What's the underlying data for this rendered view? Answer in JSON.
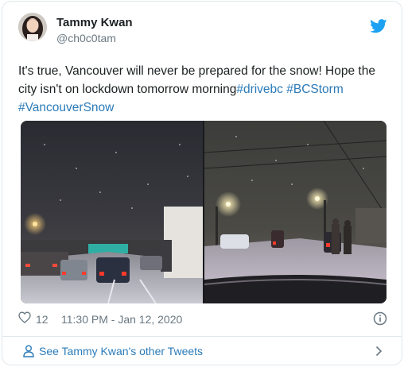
{
  "author": {
    "name": "Tammy Kwan",
    "handle": "@ch0c0tam"
  },
  "tweet": {
    "text": "It's true, Vancouver will never be prepared for the snow! Hope the city isn't on lockdown tomorrow morning",
    "hashtags": [
      "#drivebc",
      "#BCStorm",
      "#VancouverSnow"
    ]
  },
  "media": {
    "photos": [
      "photo-highway-night-snow",
      "photo-street-night-snow"
    ]
  },
  "meta": {
    "like_count": "12",
    "timestamp": "11:30 PM - Jan 12, 2020"
  },
  "footer": {
    "label": "See Tammy Kwan's other Tweets"
  },
  "icons": {
    "logo": "twitter-bird-icon",
    "like": "heart-icon",
    "info": "info-icon",
    "footer_person": "person-icon",
    "footer_arrow": "chevron-right-icon"
  },
  "colors": {
    "link": "#2b7bb9",
    "secondary_text": "#697882",
    "twitter_blue": "#1da1f2",
    "border": "#e1e8ed"
  }
}
